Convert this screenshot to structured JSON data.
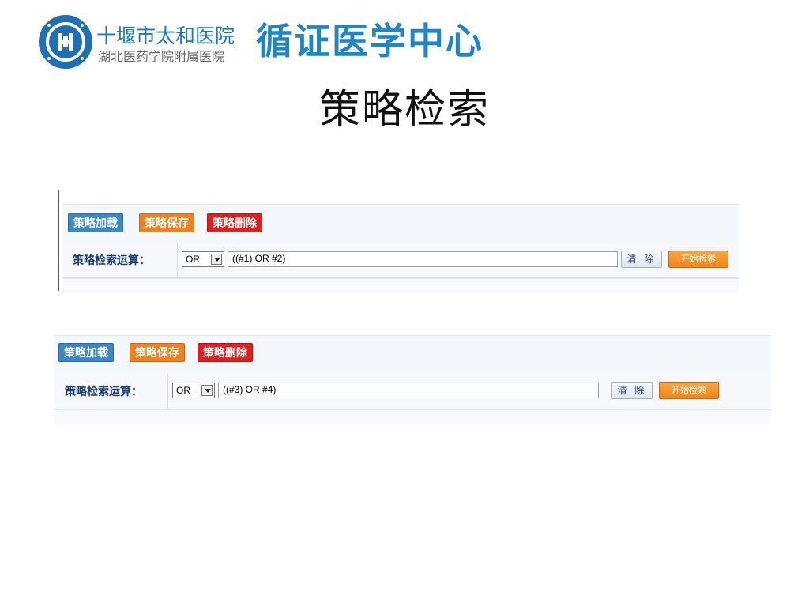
{
  "header": {
    "hospital_name": "十堰市太和医院",
    "hospital_subtitle": "湖北医药学院附属医院",
    "center_name": "循证医学中心"
  },
  "slide": {
    "title": "策略检索"
  },
  "panels": [
    {
      "buttons": {
        "load": "策略加载",
        "save": "策略保存",
        "delete": "策略删除"
      },
      "operator_label": "策略检索运算：",
      "operator_value": "OR",
      "expression": "((#1) OR #2)",
      "clear_label": "清 除",
      "search_label": "开始检索"
    },
    {
      "buttons": {
        "load": "策略加载",
        "save": "策略保存",
        "delete": "策略删除"
      },
      "operator_label": "策略检索运算：",
      "operator_value": "OR",
      "expression": "((#3) OR #4)",
      "clear_label": "清 除",
      "search_label": "开始检索"
    }
  ],
  "colors": {
    "brand_blue": "#1f84c8",
    "load_button": "#3a88c8",
    "save_button": "#f0821e",
    "delete_button": "#e02020",
    "search_button": "#f08418"
  }
}
